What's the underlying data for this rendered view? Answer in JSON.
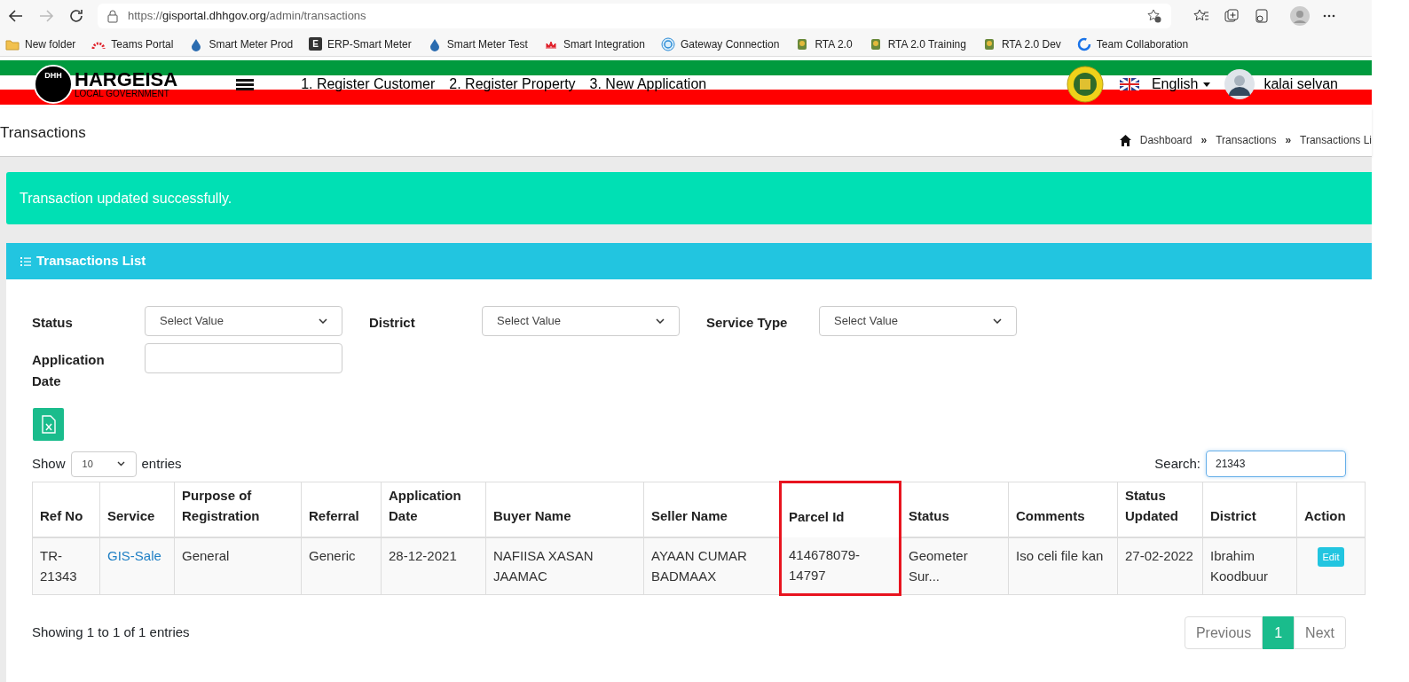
{
  "browser": {
    "url_scheme": "https://",
    "url_host": "gisportal.dhhgov.org",
    "url_path": "/admin/transactions",
    "bookmarks": [
      {
        "label": "New folder",
        "kind": "folder"
      },
      {
        "label": "Teams Portal",
        "kind": "arc"
      },
      {
        "label": "Smart Meter Prod",
        "kind": "drop"
      },
      {
        "label": "ERP-Smart Meter",
        "kind": "letter",
        "mark": "E"
      },
      {
        "label": "Smart Meter Test",
        "kind": "drop"
      },
      {
        "label": "Smart Integration",
        "kind": "lotus"
      },
      {
        "label": "Gateway Connection",
        "kind": "swirl"
      },
      {
        "label": "RTA 2.0",
        "kind": "emblem"
      },
      {
        "label": "RTA 2.0 Training",
        "kind": "emblem"
      },
      {
        "label": "RTA 2.0 Dev",
        "kind": "emblem"
      },
      {
        "label": "Team Collaboration",
        "kind": "ring"
      }
    ]
  },
  "header": {
    "logo_mark": "DHH",
    "logo_title": "HARGEISA",
    "logo_subtitle": "LOCAL GOVERNMENT",
    "nav": [
      "1. Register Customer",
      "2. Register Property",
      "3. New Application"
    ],
    "language": "English",
    "user": "kalai selvan"
  },
  "page_title": "Transactions",
  "breadcrumb": [
    "Dashboard",
    "Transactions",
    "Transactions Li"
  ],
  "breadcrumb_separator": "»",
  "alert": "Transaction updated successfully.",
  "card_title": "Transactions List",
  "filters": [
    {
      "label": "Status",
      "kind": "select",
      "value": "Select Value"
    },
    {
      "label": "District",
      "kind": "select",
      "value": "Select Value"
    },
    {
      "label": "Service Type",
      "kind": "select",
      "value": "Select Value"
    },
    {
      "label": "Application Date",
      "kind": "input"
    }
  ],
  "show_entries": {
    "before": "Show",
    "value": "10",
    "after": "entries"
  },
  "search": {
    "label": "Search:",
    "value": "21343"
  },
  "table": {
    "columns": [
      {
        "label": "Ref No",
        "highlighted": false
      },
      {
        "label": "Service",
        "highlighted": false
      },
      {
        "label": "Purpose of Registration",
        "highlighted": false
      },
      {
        "label": "Referral",
        "highlighted": false
      },
      {
        "label": "Application Date",
        "highlighted": false
      },
      {
        "label": "Buyer Name",
        "highlighted": false
      },
      {
        "label": "Seller Name",
        "highlighted": false
      },
      {
        "label": "Parcel Id",
        "highlighted": true
      },
      {
        "label": "Status",
        "highlighted": false
      },
      {
        "label": "Comments",
        "highlighted": false
      },
      {
        "label": "Status Updated",
        "highlighted": false
      },
      {
        "label": "District",
        "highlighted": false
      },
      {
        "label": "Action",
        "highlighted": false
      }
    ],
    "rows": [
      {
        "cells": [
          {
            "kind": "text",
            "text": "TR-21343"
          },
          {
            "kind": "link",
            "text": "GIS-Sale"
          },
          {
            "kind": "text",
            "text": "General"
          },
          {
            "kind": "text",
            "text": "Generic"
          },
          {
            "kind": "text",
            "text": "28-12-2021"
          },
          {
            "kind": "text",
            "text": "NAFIISA XASAN JAAMAC"
          },
          {
            "kind": "text",
            "text": "AYAAN CUMAR BADMAAX"
          },
          {
            "kind": "text",
            "text": "414678079-14797"
          },
          {
            "kind": "text",
            "text": "Geometer Sur..."
          },
          {
            "kind": "text",
            "text": "Iso celi file kan"
          },
          {
            "kind": "text",
            "text": "27-02-2022"
          },
          {
            "kind": "text",
            "text": "Ibrahim Koodbuur"
          },
          {
            "kind": "button",
            "text": "Edit"
          }
        ]
      }
    ]
  },
  "info": "Showing 1 to 1 of 1 entries",
  "pagination": [
    {
      "label": "Previous",
      "selected": false
    },
    {
      "label": "1",
      "selected": true
    },
    {
      "label": "Next",
      "selected": false
    }
  ]
}
